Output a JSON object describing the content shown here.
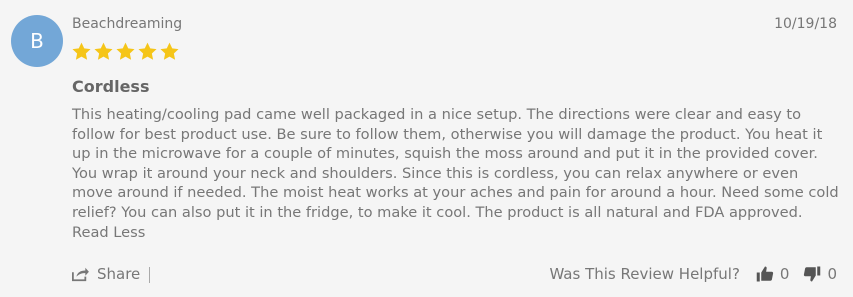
{
  "review": {
    "avatar_letter": "B",
    "username": "Beachdreaming",
    "date": "10/19/18",
    "rating": 5,
    "title": "Cordless",
    "body": "This heating/cooling pad came well packaged in a nice setup. The directions were clear and easy to follow for best product use. Be sure to follow them, otherwise you will damage the product. You heat it up in the microwave for a couple of minutes, squish the moss around and put it in the provided cover. You wrap it around your neck and shoulders. Since this is cordless, you can relax anywhere or even move around if needed. The moist heat works at your aches and pain for around a hour. Need some cold relief? You can also put it in the fridge, to make it cool. The product is all natural and FDA approved.",
    "read_less_label": "Read Less"
  },
  "actions": {
    "share_label": "Share",
    "helpful_question": "Was This Review Helpful?",
    "upvote_count": "0",
    "downvote_count": "0"
  },
  "colors": {
    "avatar_bg": "#73a7d7",
    "star": "#f5c518",
    "text": "#777777"
  },
  "icons": {
    "star": "star-icon",
    "share": "share-icon",
    "thumbs_up": "thumbs-up-icon",
    "thumbs_down": "thumbs-down-icon"
  }
}
